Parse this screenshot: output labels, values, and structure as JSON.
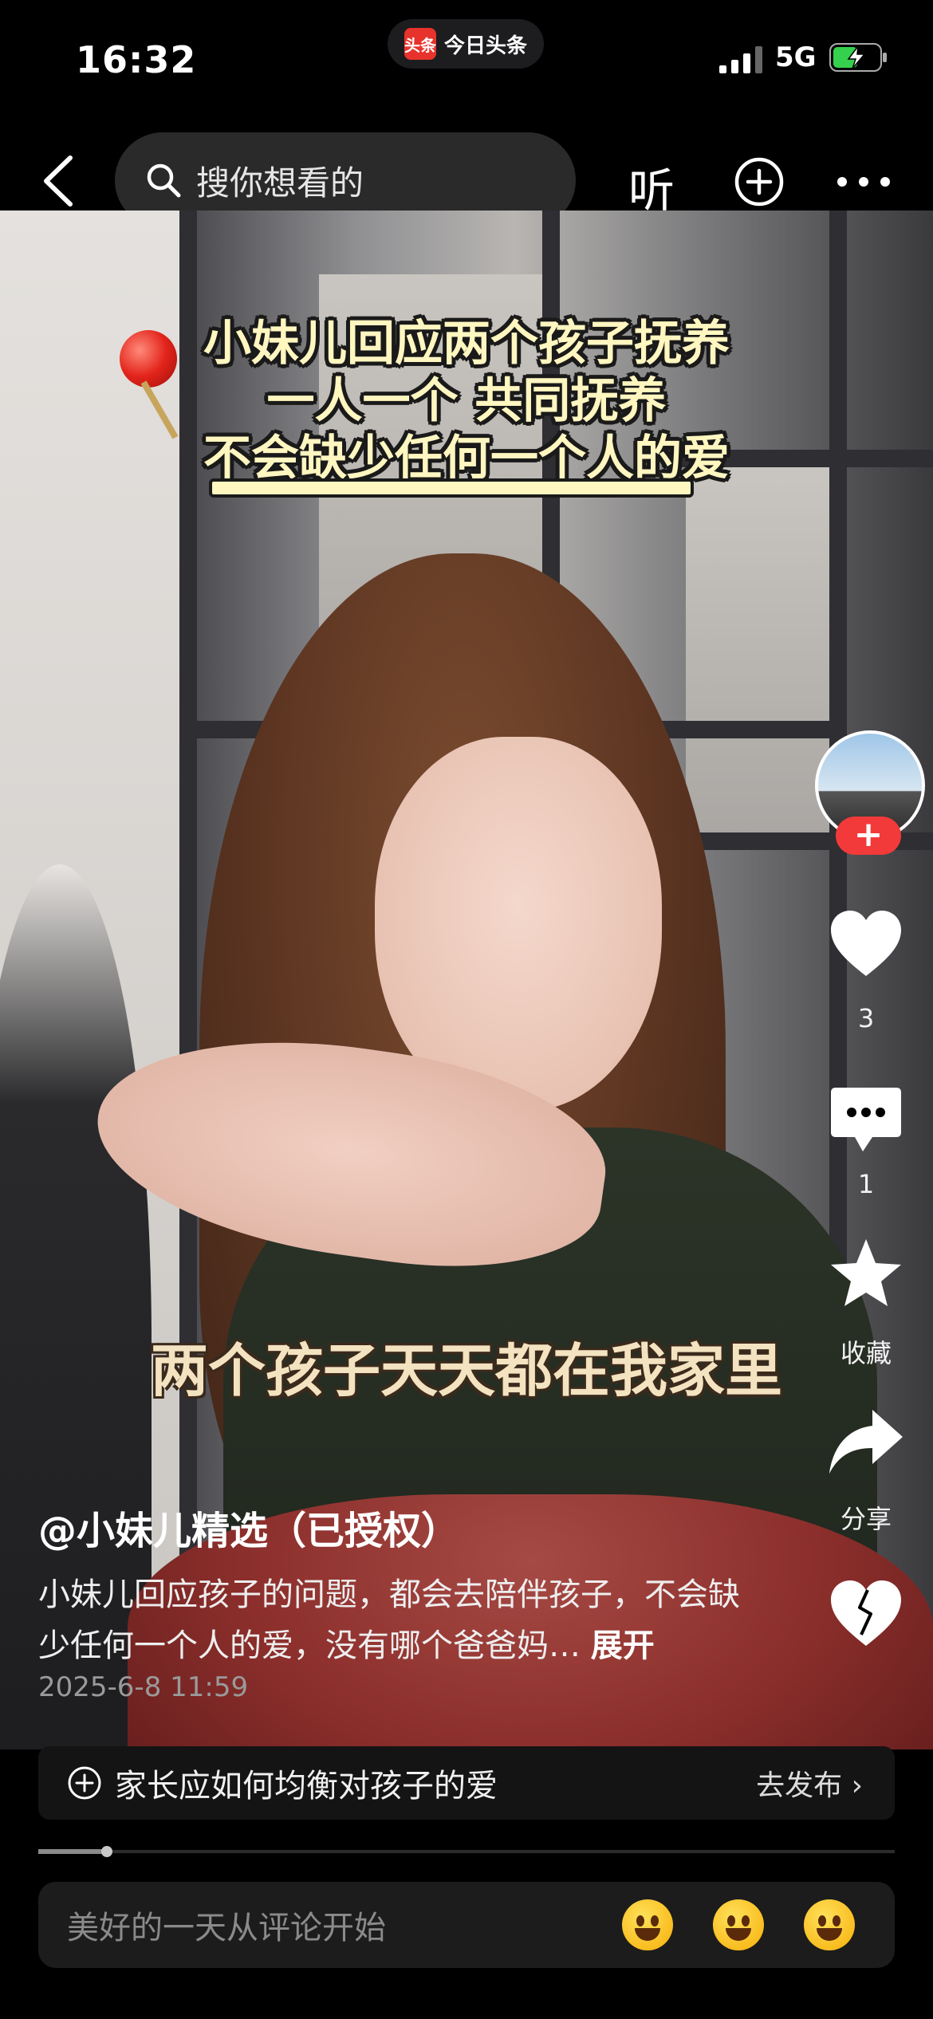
{
  "status_bar": {
    "time": "16:32",
    "app_logo_text": "头条",
    "app_name": "今日头条",
    "network": "5G"
  },
  "top_nav": {
    "search_placeholder": "搜你想看的",
    "listen_label": "听"
  },
  "video": {
    "caption_lines": [
      "小妹儿回应两个孩子抚养",
      "一人一个 共同抚养",
      "不会缺少任何一个人的爱"
    ],
    "subtitle": "两个孩子天天都在我家里"
  },
  "right_rail": {
    "follow_label": "+",
    "like_count": "3",
    "comment_count": "1",
    "favorite_label": "收藏",
    "share_label": "分享"
  },
  "post": {
    "author": "@小妹儿精选（已授权）",
    "description": "小妹儿回应孩子的问题，都会去陪伴孩子，不会缺少任何一个人的爱，没有哪个爸爸妈…",
    "expand_label": "展开",
    "date": "2025-6-8 11:59"
  },
  "topic": {
    "text": "家长应如何均衡对孩子的爱",
    "action": "去发布 ›"
  },
  "progress": {
    "fraction": 0.08
  },
  "comment": {
    "placeholder": "美好的一天从评论开始",
    "emojis": [
      "laughing-tears-emoji",
      "grinning-emoji",
      "beaming-emoji"
    ]
  },
  "colors": {
    "accent": "#f23a3a",
    "background": "#000000",
    "caption": "#fff6c0"
  }
}
